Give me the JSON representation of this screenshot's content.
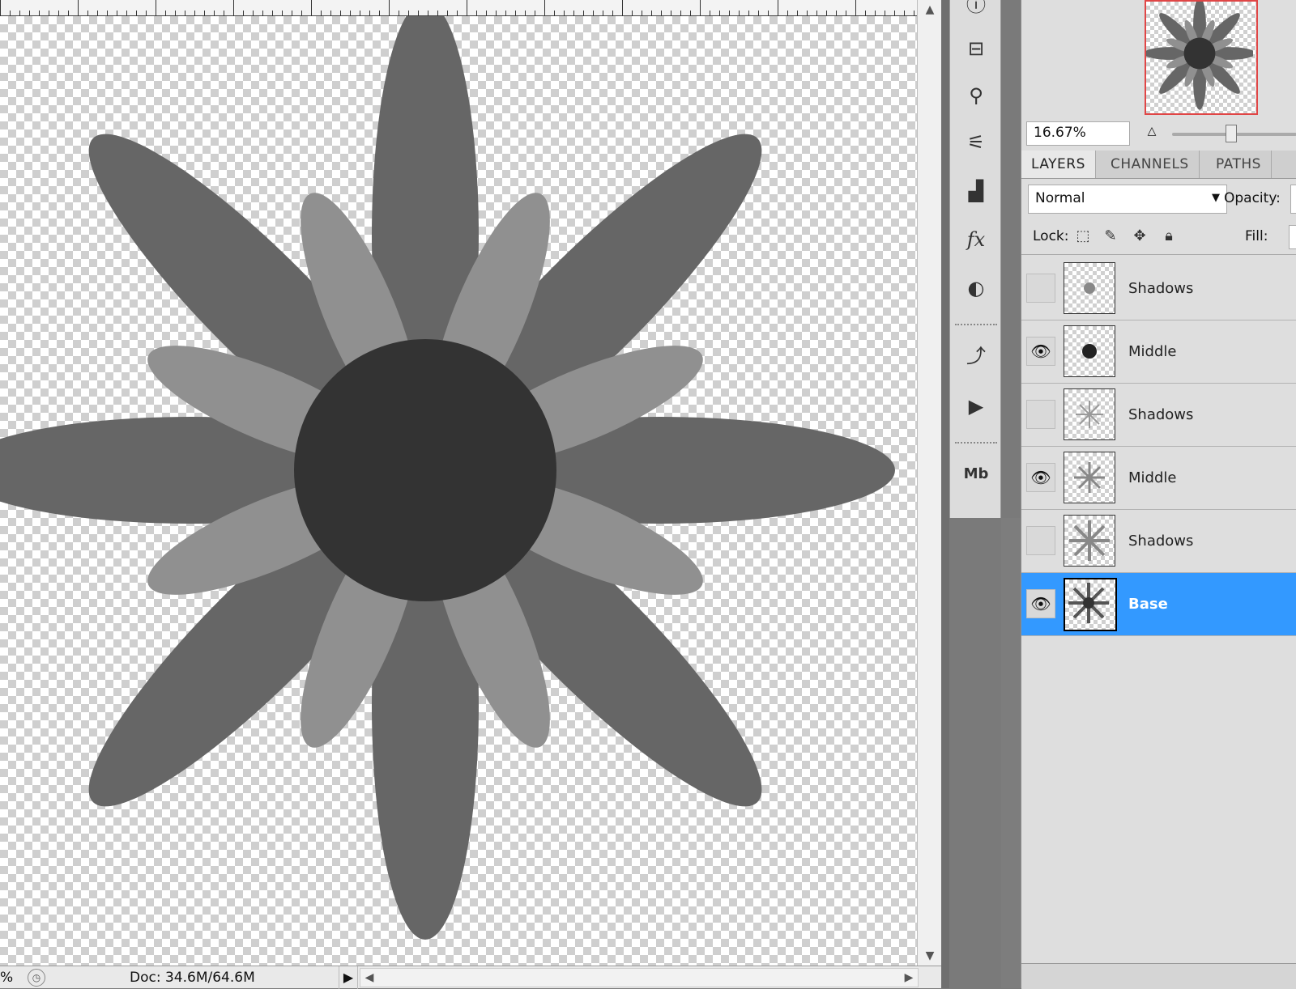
{
  "status": {
    "zoom_percent": "%",
    "doc_size": "Doc: 34.6M/64.6M",
    "menu_arrow": "▶"
  },
  "navigator": {
    "zoom": "16.67%"
  },
  "panel": {
    "tabs": [
      {
        "label": "LAYERS",
        "active": true
      },
      {
        "label": "CHANNELS",
        "active": false
      },
      {
        "label": "PATHS",
        "active": false
      }
    ],
    "blend_mode": "Normal",
    "opacity_label": "Opacity:",
    "lock_label": "Lock:",
    "fill_label": "Fill:"
  },
  "layers": [
    {
      "name": "Shadows",
      "visible": false,
      "selected": false
    },
    {
      "name": "Middle",
      "visible": true,
      "selected": false
    },
    {
      "name": "Shadows",
      "visible": false,
      "selected": false
    },
    {
      "name": "Middle",
      "visible": true,
      "selected": false
    },
    {
      "name": "Shadows",
      "visible": false,
      "selected": false
    },
    {
      "name": "Base",
      "visible": true,
      "selected": true
    }
  ],
  "colors": {
    "selection": "#3399ff",
    "outer_petal": "#666666",
    "inner_petal": "#909090",
    "center": "#333333",
    "navigator_frame": "#e04646"
  },
  "icons": {
    "tools": [
      "info-icon",
      "clone-source-icon",
      "brush-preset-icon",
      "tool-preset-icon",
      "histogram-icon",
      "styles-fx-icon",
      "adjustments-icon",
      "history-icon",
      "actions-icon",
      "mini-bridge-icon"
    ]
  }
}
